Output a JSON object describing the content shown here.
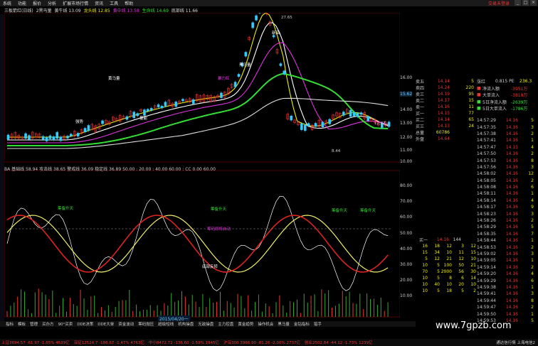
{
  "menu": {
    "items": [
      "系统",
      "功能",
      "报价",
      "分析",
      "扩展市场行情",
      "资讯",
      "工具",
      "帮助"
    ],
    "brand": "交易未登录"
  },
  "info": {
    "name": "三板箭红(日线)",
    "ma1": "2黑马量",
    "ma2": "黄牛线 13.09",
    "ma3": "龙头线 12.85",
    "ma4": "黄中线 13.58",
    "ma5": "生命线 14.69",
    "ma6": "底部线 11.66"
  },
  "scale_price": [
    "16.00",
    "15.62",
    "14.00",
    "13.00",
    "12.00",
    "11.00",
    "10.00"
  ],
  "scale_osc": [
    "80.00",
    "70.00",
    "60.00",
    "50.00",
    "40.00",
    "30.00",
    "20.00",
    "10.00"
  ],
  "chart_labels": {
    "high": "27.65",
    "low": "8.44",
    "right": "12.87",
    "annotations": [
      "黄马量",
      "暴力红",
      "强势",
      "黑马量",
      "新高",
      "量能"
    ],
    "rise": [
      "筹备升天",
      "筹备升天",
      "筹备升天",
      "筹备升天"
    ],
    "cross": "筹码即将启动",
    "bottom": "底部反转"
  },
  "secinfo": "BA  基础线 58.94  攻击线 38.65  警戒线 36.09  稳定线 36.89  50.00 : 20.00 : 40.00  60.00 : CC 0.00  60.00",
  "quote": {
    "sell": [
      {
        "lbl": "卖五",
        "price": "14.14",
        "vol": "5"
      },
      {
        "lbl": "卖四",
        "price": "14.24",
        "vol": "220"
      },
      {
        "lbl": "卖三",
        "price": "14.19",
        "vol": "95"
      },
      {
        "lbl": "卖二",
        "price": "14.17",
        "vol": "15"
      },
      {
        "lbl": "卖一",
        "price": "14.16",
        "vol": "11"
      }
    ],
    "buy": [
      {
        "lbl": "买一",
        "price": "14.15",
        "vol": "77"
      },
      {
        "lbl": "买二",
        "price": "14.14",
        "vol": "65"
      },
      {
        "lbl": "买三",
        "price": "14.13",
        "vol": "24"
      }
    ],
    "summary": [
      {
        "lbl": "总量",
        "val": "60786"
      },
      {
        "lbl": "外盘",
        "val": "14.64"
      }
    ]
  },
  "funds": {
    "header": [
      "涨红",
      "0.815 PE",
      "236.3"
    ],
    "rows": [
      {
        "lbl": "净流入额",
        "val": "-3951万"
      },
      {
        "lbl": "大单流入",
        "val": "-3818万"
      },
      {
        "lbl": "5日净流入额",
        "val": "-2639万"
      },
      {
        "lbl": "5日大单流入",
        "val": "-1786万"
      }
    ]
  },
  "ticks": [
    {
      "t": "14:57:29",
      "p": "14.16",
      "v": "5"
    },
    {
      "t": "14:57:35",
      "p": "14.16",
      "v": "3"
    },
    {
      "t": "14:57:38",
      "p": "14.16",
      "v": "2"
    },
    {
      "t": "14:57:41",
      "p": "14.16",
      "v": "1"
    },
    {
      "t": "14:57:47",
      "p": "14.15",
      "v": "4"
    },
    {
      "t": "14:57:50",
      "p": "14.16",
      "v": "2"
    },
    {
      "t": "14:57:53",
      "p": "14.16",
      "v": "8"
    },
    {
      "t": "14:57:56",
      "p": "14.16",
      "v": "3"
    },
    {
      "t": "14:58:02",
      "p": "14.16",
      "v": "12"
    },
    {
      "t": "14:58:05",
      "p": "14.16",
      "v": "2"
    },
    {
      "t": "14:58:08",
      "p": "14.16",
      "v": "6"
    },
    {
      "t": "14:58:11",
      "p": "14.16",
      "v": "1"
    },
    {
      "t": "14:58:14",
      "p": "14.16",
      "v": "4"
    },
    {
      "t": "14:58:17",
      "p": "14.16",
      "v": "9"
    },
    {
      "t": "14:58:23",
      "p": "14.16",
      "v": "3"
    },
    {
      "t": "14:58:26",
      "p": "14.16",
      "v": "2"
    },
    {
      "t": "14:58:29",
      "p": "14.16",
      "v": "5"
    },
    {
      "t": "14:58:35",
      "p": "14.16",
      "v": "7"
    },
    {
      "t": "14:58:44",
      "p": "14.16",
      "v": "1"
    },
    {
      "t": "14:58:53",
      "p": "14.16",
      "v": "2"
    },
    {
      "t": "14:59:02",
      "p": "14.16",
      "v": "3"
    },
    {
      "t": "14:59:05",
      "p": "14.16",
      "v": "1"
    },
    {
      "t": "14:59:14",
      "p": "14.16",
      "v": "2"
    },
    {
      "t": "14:59:20",
      "p": "14.16",
      "v": "4"
    },
    {
      "t": "14:59:29",
      "p": "14.16",
      "v": "6"
    },
    {
      "t": "14:59:38",
      "p": "14.16",
      "v": "1"
    },
    {
      "t": "14:59:41",
      "p": "14.16",
      "v": "3"
    },
    {
      "t": "14:59:44",
      "p": "14.16",
      "v": "8"
    },
    {
      "t": "14:59:47",
      "p": "14.16",
      "v": "2"
    },
    {
      "t": "14:59:50",
      "p": "14.16",
      "v": "1"
    },
    {
      "t": "14:59:53",
      "p": "14.16",
      "v": "5"
    }
  ],
  "level2": {
    "title": [
      "买一",
      "14.16",
      "144"
    ],
    "rows": [
      [
        "16",
        "18",
        "12",
        "3",
        "12"
      ],
      [
        "15",
        "34",
        "10",
        "11",
        "15"
      ],
      [
        "5",
        "12",
        "21",
        "12",
        "10"
      ],
      [
        "10",
        "5",
        "100",
        "50",
        "21"
      ],
      [
        "70",
        "5",
        "2000",
        "56",
        "30"
      ],
      [
        "10",
        "5",
        "8",
        "6",
        "14"
      ],
      [
        "10",
        "40",
        "10",
        "20",
        "10"
      ],
      [
        "10",
        "5",
        "18",
        "5",
        "2"
      ]
    ]
  },
  "date": "2015/04/20一",
  "bottomtabs": [
    "指标",
    "模板",
    "管理",
    "买办方",
    "90°买卖",
    "DDE决策",
    "DDE大单",
    "资金波动",
    "筹码抛压",
    "超级短线",
    "机构操盘",
    "无敌操盘",
    "主力控盘",
    "黄金趋势",
    "操作机会",
    "黑马量",
    "金钻指标",
    "猎手"
  ],
  "statusbar": {
    "items": [
      "上证3694.57 -61.97 -1.65% 4639亿",
      "深证12524.7 -186.67 -1.47% 4763亿",
      "中小8472.72 -136.60 -1.59% 1945亿",
      "沪深300 3966.90 -81.26 -2.00% 2737亿",
      "创业2502.84 -44.12 -1.73% 1239亿"
    ],
    "right": "通达信行情 上海电信2"
  },
  "watermark": "www.7gpzb.com",
  "chart_data": {
    "type": "candlestick",
    "price_ylim": [
      10,
      16
    ],
    "osc_ylim": [
      0,
      90
    ]
  }
}
